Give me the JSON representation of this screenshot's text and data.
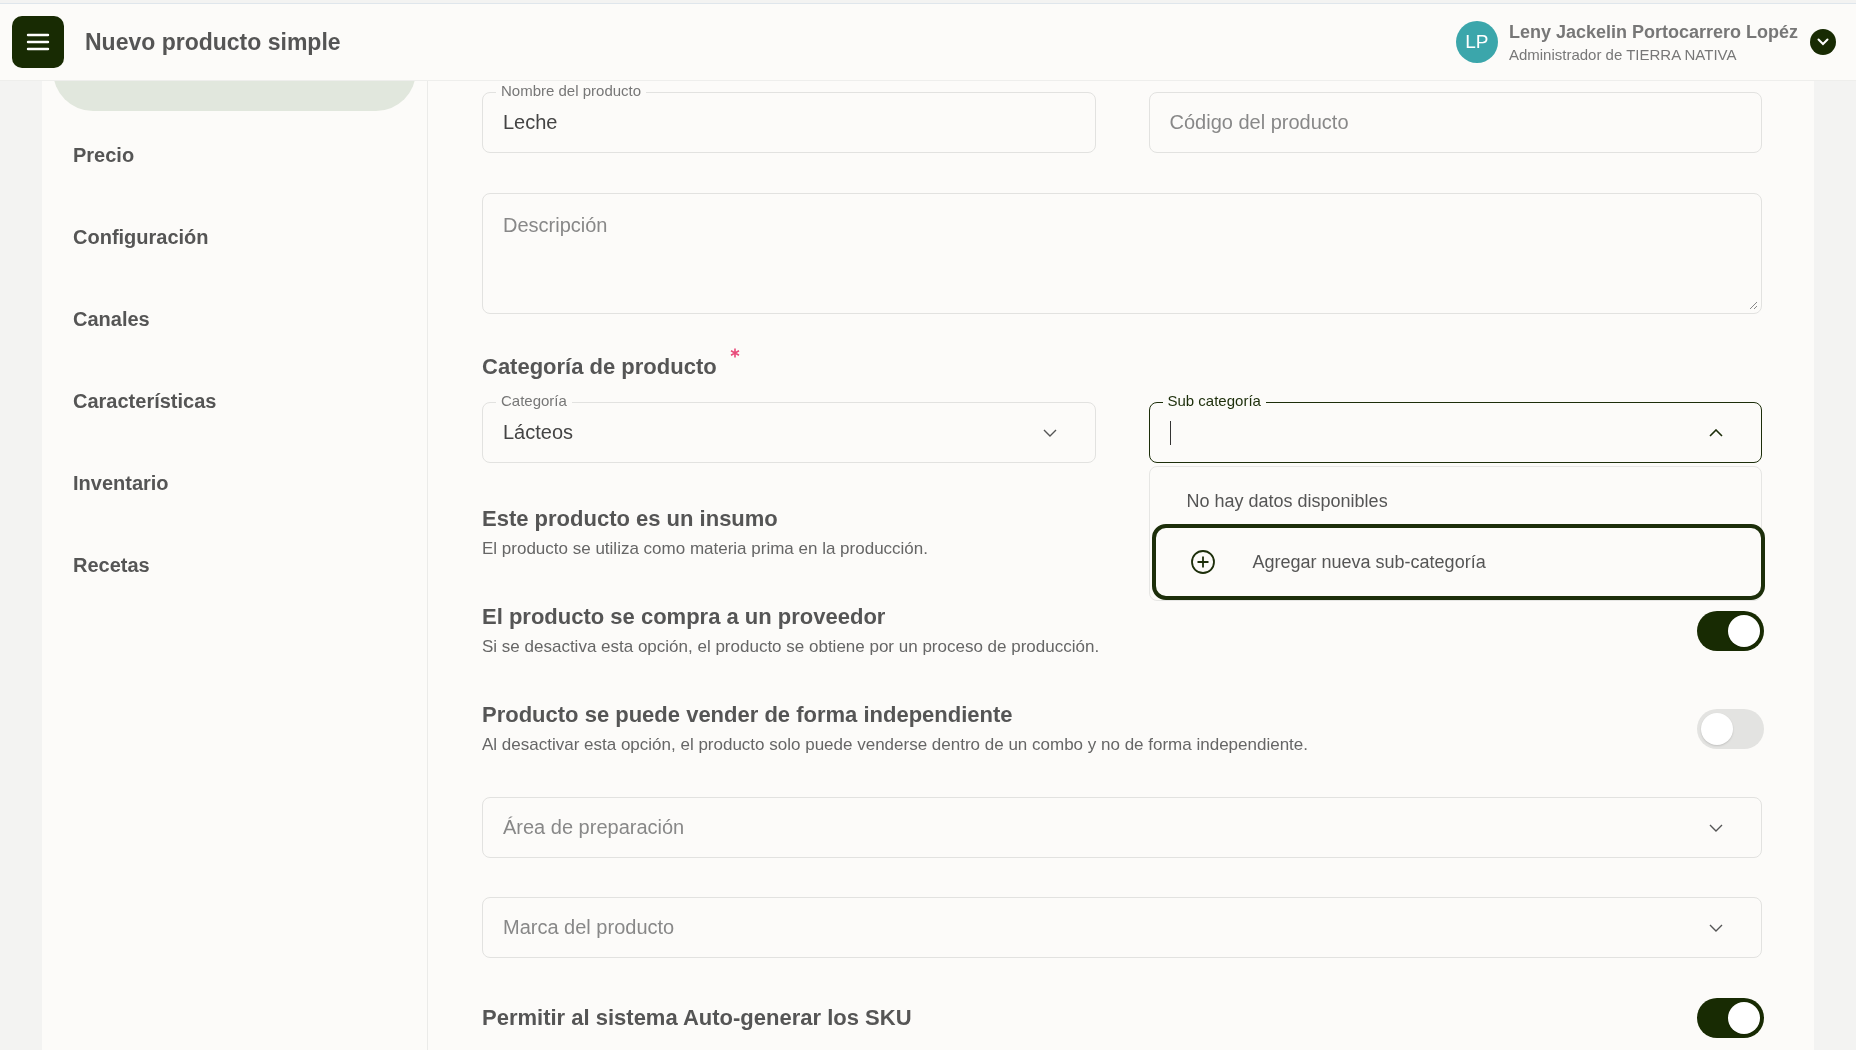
{
  "header": {
    "title": "Nuevo producto simple",
    "user": {
      "initials": "LP",
      "name": "Leny Jackelin Portocarrero Lopéz",
      "role": "Administrador de TIERRA NATIVA"
    }
  },
  "sidebar": {
    "items": [
      {
        "label": "Precio"
      },
      {
        "label": "Configuración"
      },
      {
        "label": "Canales"
      },
      {
        "label": "Características"
      },
      {
        "label": "Inventario"
      },
      {
        "label": "Recetas"
      }
    ]
  },
  "form": {
    "name": {
      "label": "Nombre del producto",
      "value": "Leche"
    },
    "code": {
      "placeholder": "Código del producto"
    },
    "description": {
      "placeholder": "Descripción"
    },
    "category_section": {
      "title": "Categoría de producto",
      "required": true
    },
    "category": {
      "label": "Categoría",
      "value": "Lácteos"
    },
    "subcategory": {
      "label": "Sub categoría",
      "expanded": true,
      "dropdown": {
        "empty_text": "No hay datos disponibles",
        "add_option": "Agregar nueva sub-categoría"
      }
    },
    "options": [
      {
        "title": "Este producto es un insumo",
        "description": "El producto se utiliza como materia prima en la producción."
      },
      {
        "title": "El producto se compra a un proveedor",
        "description": "Si se desactiva esta opción, el producto se obtiene por un proceso de producción.",
        "on": true
      },
      {
        "title": "Producto se puede vender de forma independiente",
        "description": "Al desactivar esta opción, el producto solo puede venderse dentro de un combo y no de forma independiente.",
        "on": false
      }
    ],
    "area": {
      "placeholder": "Área de preparación"
    },
    "brand": {
      "placeholder": "Marca del producto"
    },
    "sku": {
      "title": "Permitir al sistema Auto-generar los SKU",
      "on": true
    }
  }
}
